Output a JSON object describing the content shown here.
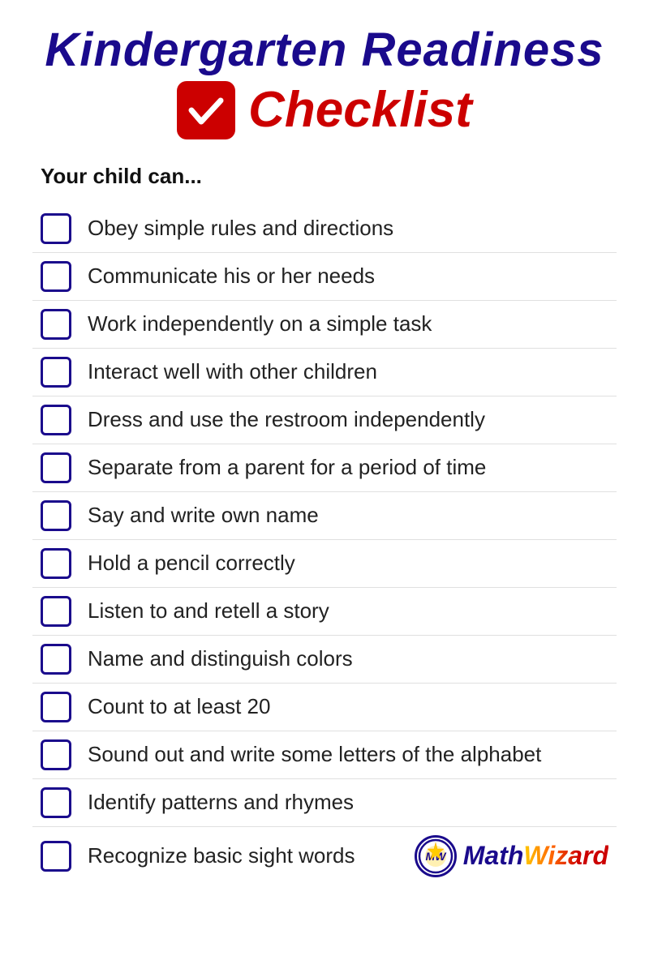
{
  "header": {
    "title_line1": "Kindergarten Readiness",
    "checklist_word": "Checklist"
  },
  "subtitle": "Your child can...",
  "items": [
    {
      "id": 1,
      "text": "Obey simple rules and directions"
    },
    {
      "id": 2,
      "text": "Communicate his or her needs"
    },
    {
      "id": 3,
      "text": "Work independently on a simple task"
    },
    {
      "id": 4,
      "text": "Interact well with other children"
    },
    {
      "id": 5,
      "text": "Dress and use the restroom independently"
    },
    {
      "id": 6,
      "text": "Separate from a parent for a period of time"
    },
    {
      "id": 7,
      "text": "Say and write own name"
    },
    {
      "id": 8,
      "text": "Hold a pencil correctly"
    },
    {
      "id": 9,
      "text": "Listen to and retell a story"
    },
    {
      "id": 10,
      "text": "Name and distinguish colors"
    },
    {
      "id": 11,
      "text": "Count to at least 20"
    },
    {
      "id": 12,
      "text": "Sound out and write some letters of the alphabet"
    },
    {
      "id": 13,
      "text": "Identify patterns and rhymes"
    },
    {
      "id": 14,
      "text": "Recognize basic sight words"
    }
  ],
  "logo": {
    "math": "Math",
    "wizard": "Wizard"
  }
}
